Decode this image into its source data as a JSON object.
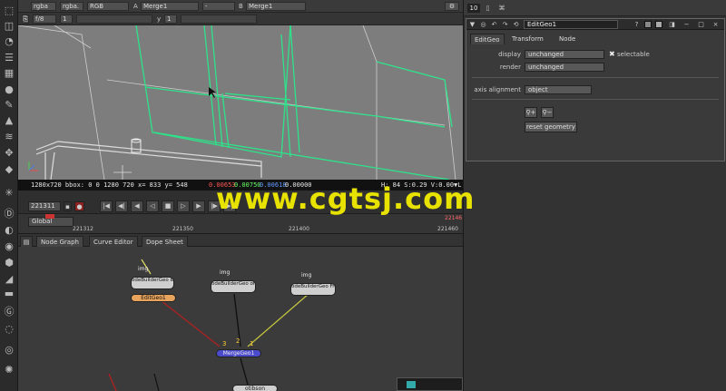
{
  "viewer": {
    "channels": "rgba",
    "channels_alpha": "rgba.",
    "display_mode": "RGB",
    "input_a_label": "A",
    "input_a": "Merge1",
    "compare_op": "-",
    "input_b_label": "B",
    "input_b": "Merge1",
    "proxy": "f/8",
    "gain_value": "1",
    "gamma_label": "y",
    "gamma_value": "1"
  },
  "info_bar": {
    "format": "1280x720 bbox: 0 0 1280 720 x= 833 y= 548",
    "red": "0.00653",
    "green": "0.00750",
    "blue": "0.00618",
    "alpha": "0.00000",
    "hsvl": "H: 84 S:0.29 V:0.00 L: 0.00712"
  },
  "timeline": {
    "current_frame": "221311",
    "range": "Global",
    "ticks": [
      "221312",
      "221350",
      "221400",
      "221460"
    ],
    "out_point": "22146"
  },
  "node_graph_tabs": [
    "Node Graph",
    "Curve Editor",
    "Dope Sheet"
  ],
  "nodes": {
    "img1": "img",
    "img2": "img",
    "img3": "img",
    "backwall": "odeBuilderGeo BackWall",
    "coffee": "odeBuilderGeo offee_can_02",
    "frontwall": "odeBuilderGeo Front_Wall",
    "editgeo": "EditGeo1",
    "mergegeo": "MergeGeo1",
    "bottom": "otibson",
    "pin3": "3",
    "pin2": "2",
    "pin1": "1"
  },
  "properties": {
    "max_panels": "10",
    "node_name": "EditGeo1",
    "tabs": [
      "EditGeo",
      "Transform",
      "Node"
    ],
    "display_label": "display",
    "display_value": "unchanged",
    "selectable_label": "selectable",
    "render_label": "render",
    "render_value": "unchanged",
    "axis_label": "axis alignment",
    "axis_value": "object",
    "reset_label": "reset geometry"
  },
  "watermark": "www.cgtsj.com",
  "colors": {
    "wireframe": "#2de38a",
    "editgeo_node": "#e8a35c",
    "mergegeo_node": "#4b4bcc",
    "watermark": "#e8e200"
  }
}
